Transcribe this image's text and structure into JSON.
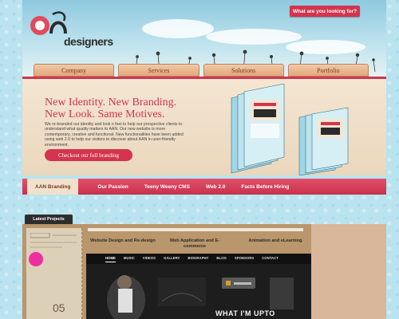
{
  "header": {
    "logo_text": "designers",
    "search_label": "What are you looking for?"
  },
  "nav": {
    "items": [
      "Company",
      "Services",
      "Solutions",
      "Portfolio"
    ]
  },
  "hero": {
    "title_line1": "New Identity. New Branding.",
    "title_line2": "New Look. Same Motives.",
    "body": "We re-branded our identity and look n feel to help our prospective clients to understand what quality matters to AAN. Our new website is more contemporary, creative and functional. New functionalities have been added using web 2.0 to help our visitors to discover about AAN in user-friendly environment.",
    "cta_label": "Checkout our full branding"
  },
  "tabs": {
    "items": [
      "AAN Branding",
      "Our Passion",
      "Teeny Weeny CMS",
      "Web 2.0",
      "Facts Before Hiring"
    ],
    "active_index": 0
  },
  "latest": {
    "label": "Latest Projects",
    "number": "05",
    "projects": [
      "Website Design and Re-design",
      "Web Application and E-commerce",
      "Animation and eLearning"
    ],
    "site_nav": [
      "HOME",
      "MUSIC",
      "VIDEOS",
      "GALLERY",
      "BIOGRAPHY",
      "BLOG",
      "SPONSORS",
      "CONTACT"
    ],
    "site_headline": "WHAT I'M UPTO"
  },
  "colors": {
    "accent": "#d4344d",
    "sky": "#b9e3ee",
    "tab_brown": "#7a3b1c"
  }
}
